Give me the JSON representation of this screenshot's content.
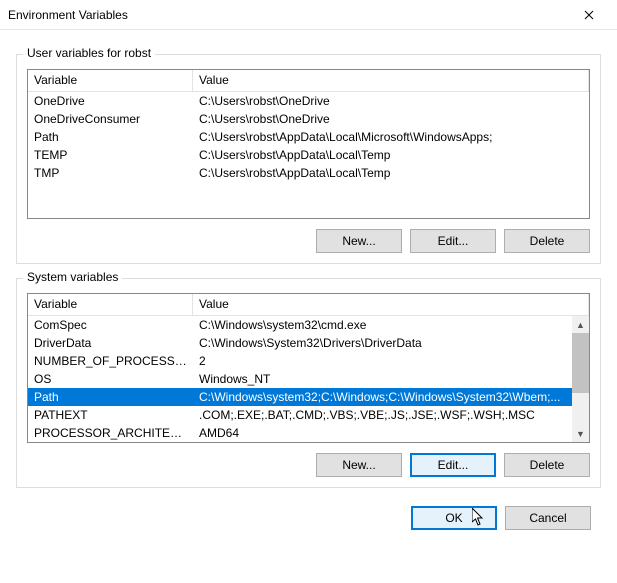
{
  "window": {
    "title": "Environment Variables"
  },
  "userVars": {
    "groupLabel": "User variables for robst",
    "headers": {
      "variable": "Variable",
      "value": "Value"
    },
    "rows": [
      {
        "name": "OneDrive",
        "value": "C:\\Users\\robst\\OneDrive"
      },
      {
        "name": "OneDriveConsumer",
        "value": "C:\\Users\\robst\\OneDrive"
      },
      {
        "name": "Path",
        "value": "C:\\Users\\robst\\AppData\\Local\\Microsoft\\WindowsApps;"
      },
      {
        "name": "TEMP",
        "value": "C:\\Users\\robst\\AppData\\Local\\Temp"
      },
      {
        "name": "TMP",
        "value": "C:\\Users\\robst\\AppData\\Local\\Temp"
      }
    ],
    "buttons": {
      "new": "New...",
      "edit": "Edit...",
      "delete": "Delete"
    }
  },
  "sysVars": {
    "groupLabel": "System variables",
    "headers": {
      "variable": "Variable",
      "value": "Value"
    },
    "selectedIndex": 4,
    "rows": [
      {
        "name": "ComSpec",
        "value": "C:\\Windows\\system32\\cmd.exe"
      },
      {
        "name": "DriverData",
        "value": "C:\\Windows\\System32\\Drivers\\DriverData"
      },
      {
        "name": "NUMBER_OF_PROCESSORS",
        "value": "2"
      },
      {
        "name": "OS",
        "value": "Windows_NT"
      },
      {
        "name": "Path",
        "value": "C:\\Windows\\system32;C:\\Windows;C:\\Windows\\System32\\Wbem;..."
      },
      {
        "name": "PATHEXT",
        "value": ".COM;.EXE;.BAT;.CMD;.VBS;.VBE;.JS;.JSE;.WSF;.WSH;.MSC"
      },
      {
        "name": "PROCESSOR_ARCHITECTURE",
        "value": "AMD64"
      }
    ],
    "buttons": {
      "new": "New...",
      "edit": "Edit...",
      "delete": "Delete"
    }
  },
  "footer": {
    "ok": "OK",
    "cancel": "Cancel"
  }
}
